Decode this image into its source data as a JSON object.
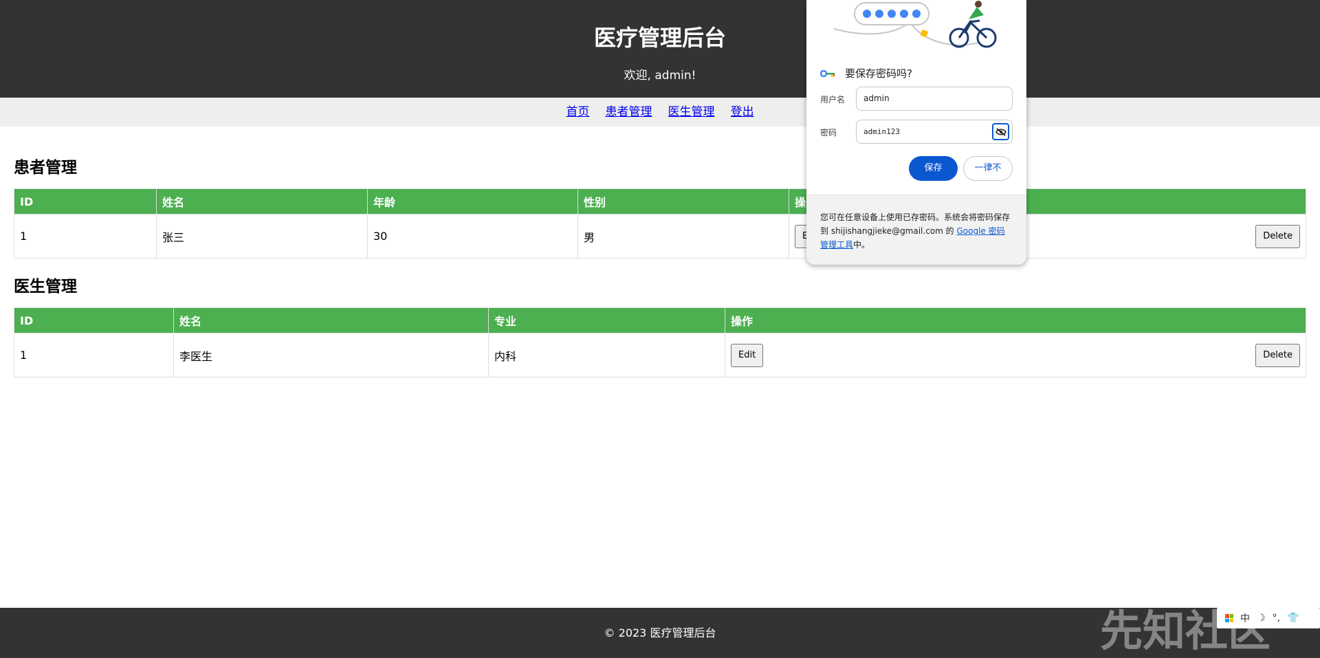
{
  "header": {
    "title": "医疗管理后台",
    "welcome": "欢迎, admin!"
  },
  "nav": {
    "items": [
      "首页",
      "患者管理",
      "医生管理",
      "登出"
    ]
  },
  "patients": {
    "title": "患者管理",
    "columns": [
      "ID",
      "姓名",
      "年龄",
      "性别",
      "操作"
    ],
    "rows": [
      {
        "id": "1",
        "name": "张三",
        "age": "30",
        "gender": "男"
      }
    ],
    "edit_label": "Edit",
    "delete_label": "Delete"
  },
  "doctors": {
    "title": "医生管理",
    "columns": [
      "ID",
      "姓名",
      "专业",
      "操作"
    ],
    "rows": [
      {
        "id": "1",
        "name": "李医生",
        "specialty": "内科"
      }
    ],
    "edit_label": "Edit",
    "delete_label": "Delete"
  },
  "footer": {
    "text": "© 2023 医疗管理后台"
  },
  "password_popup": {
    "title": "要保存密码吗?",
    "username_label": "用户名",
    "username_value": "admin",
    "password_label": "密码",
    "password_value": "admin123",
    "save_label": "保存",
    "never_label": "一律不",
    "footer_text_1": "您可在任意设备上使用已存密码。系统会将密码保存到 shijishangjieke@gmail.com 的 ",
    "footer_link": "Google 密码管理工具",
    "footer_text_2": "中。",
    "icon": "key-icon",
    "colors": {
      "primary": "#0b57d0"
    }
  },
  "watermark": {
    "text": "先知社区"
  },
  "ime": {
    "mode": "中",
    "icons": [
      "windows-grid-icon",
      "moon-icon",
      "punctuation-icon",
      "shirt-icon"
    ]
  },
  "colors": {
    "header_bg": "#333333",
    "table_header": "#4caf50",
    "nav_bg": "#eeeeee"
  }
}
